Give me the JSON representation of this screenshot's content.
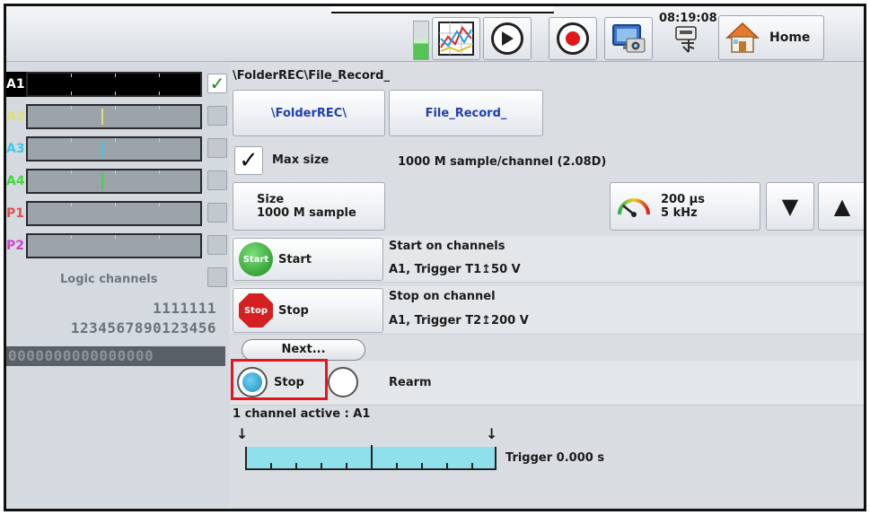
{
  "topbar": {
    "time": "08:19:08",
    "home_label": "Home"
  },
  "channels": [
    {
      "label": "A1",
      "color": "#ffffff",
      "enabled": true
    },
    {
      "label": "A2",
      "color": "#e0e070",
      "enabled": false
    },
    {
      "label": "A3",
      "color": "#40c8e8",
      "enabled": false
    },
    {
      "label": "A4",
      "color": "#40d840",
      "enabled": false
    },
    {
      "label": "P1",
      "color": "#e05050",
      "enabled": false
    },
    {
      "label": "P2",
      "color": "#d040d0",
      "enabled": false
    }
  ],
  "logic": {
    "title": "Logic channels",
    "row1": "1111111",
    "row2": "1234567890123456",
    "row3": "0000000000000000"
  },
  "main": {
    "path": "\\FolderREC\\File_Record_",
    "folder_button": "\\FolderREC\\",
    "file_button": "File_Record_",
    "max_size_label": "Max size",
    "max_size_value": "1000 M sample/channel (2.08D)",
    "size_label": "Size",
    "size_value": "1000  M sample",
    "period": "200 µs",
    "frequency": "5 kHz",
    "start_label": "Start",
    "start_icon_text": "Start",
    "start_title": "Start on channels",
    "start_detail": "A1, Trigger T1↥50 V",
    "stop_label": "Stop",
    "stop_icon_text": "Stop",
    "stop_title": "Stop on channel",
    "stop_detail": "A1, Trigger T2↥200 V",
    "next_label": "Next...",
    "radio_stop": "Stop",
    "radio_rearm": "Rearm",
    "active_label": "1 channel active : A1",
    "trigger_label": "Trigger 0.000 s"
  },
  "colors": {
    "accent_blue": "#1f3fb0",
    "highlight": "#e8141b"
  }
}
